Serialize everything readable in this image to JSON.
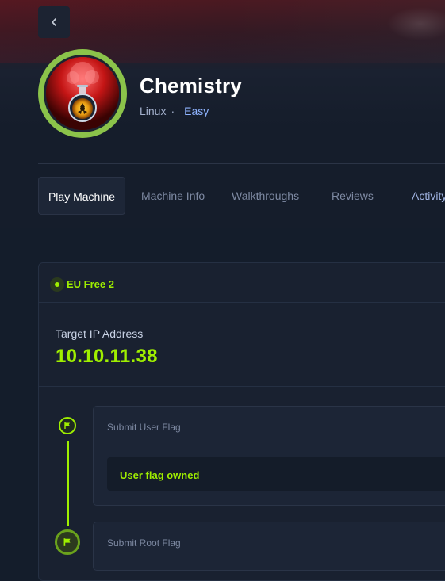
{
  "nav": {
    "back_icon": "chevron-left-icon"
  },
  "machine": {
    "name": "Chemistry",
    "os": "Linux",
    "separator": "·",
    "difficulty": "Easy",
    "avatar": "chemistry-flask-biohazard-logo"
  },
  "tabs": [
    {
      "label": "Play Machine",
      "active": true
    },
    {
      "label": "Machine Info",
      "active": false
    },
    {
      "label": "Walkthroughs",
      "active": false
    },
    {
      "label": "Reviews",
      "active": false
    },
    {
      "label": "Activity",
      "active": false
    }
  ],
  "server": {
    "name": "EU Free 2",
    "status_color": "#9fef00"
  },
  "target": {
    "label": "Target IP Address",
    "ip": "10.10.11.38"
  },
  "flags": {
    "user": {
      "title": "Submit User Flag",
      "status": "User flag owned"
    },
    "root": {
      "title": "Submit Root Flag"
    }
  },
  "colors": {
    "accent": "#9fef00",
    "background": "#141d2b",
    "difficulty_easy": "#8fb4ff"
  }
}
